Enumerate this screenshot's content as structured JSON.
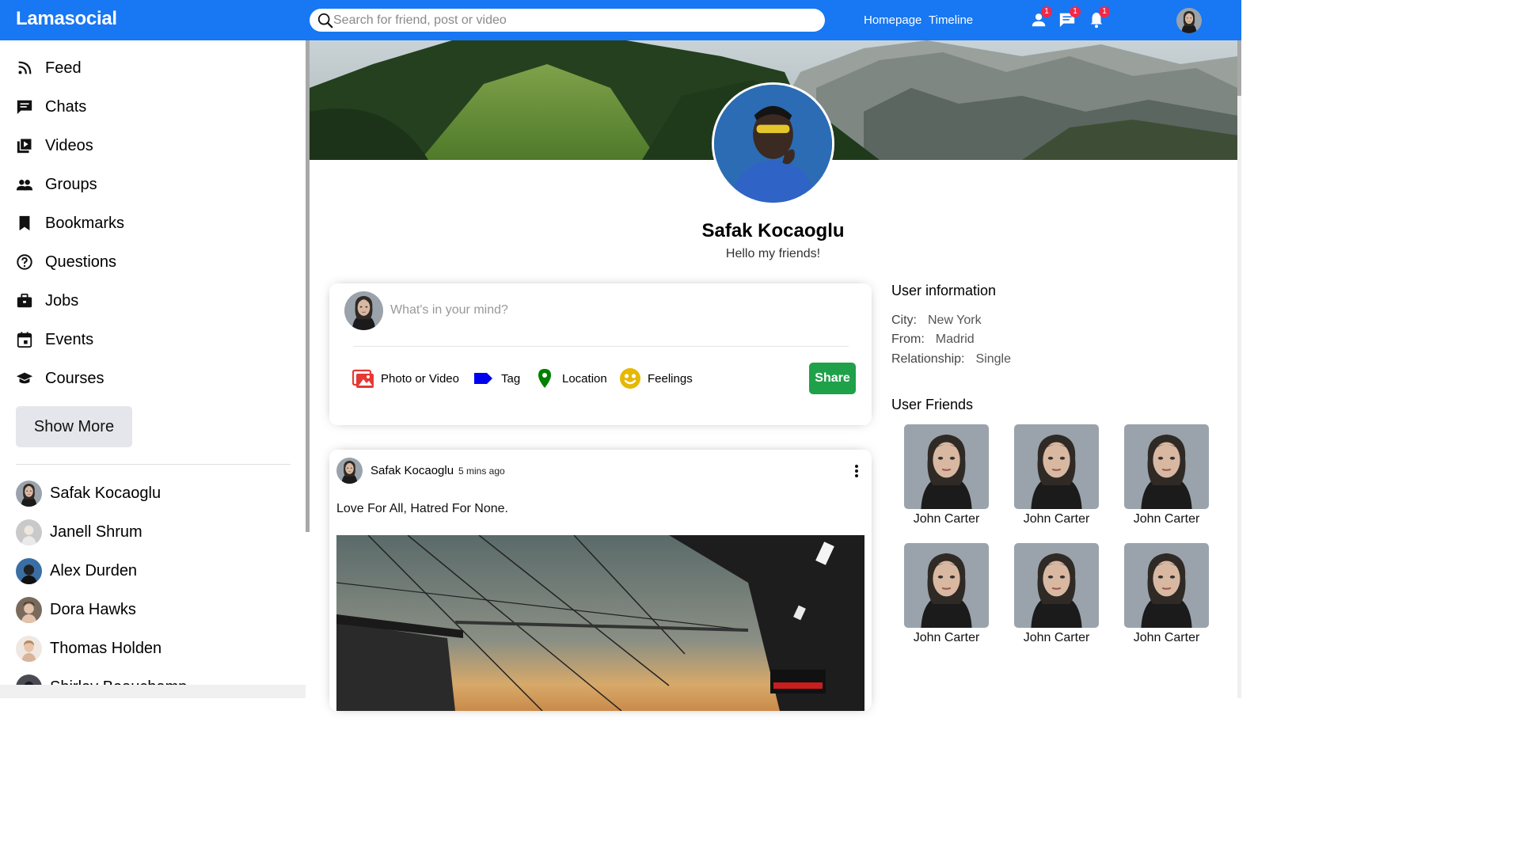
{
  "app": {
    "logo": "Lamasocial"
  },
  "topbar": {
    "search_placeholder": "Search for friend, post or video",
    "links": [
      "Homepage",
      "Timeline"
    ],
    "icons": [
      {
        "name": "person-icon",
        "badge": "1"
      },
      {
        "name": "chat-icon",
        "badge": "1"
      },
      {
        "name": "notification-icon",
        "badge": "1"
      }
    ]
  },
  "sidebar": {
    "items": [
      {
        "label": "Feed",
        "icon": "rss-icon"
      },
      {
        "label": "Chats",
        "icon": "chat-icon"
      },
      {
        "label": "Videos",
        "icon": "video-icon"
      },
      {
        "label": "Groups",
        "icon": "group-icon"
      },
      {
        "label": "Bookmarks",
        "icon": "bookmark-icon"
      },
      {
        "label": "Questions",
        "icon": "help-icon"
      },
      {
        "label": "Jobs",
        "icon": "work-icon"
      },
      {
        "label": "Events",
        "icon": "event-icon"
      },
      {
        "label": "Courses",
        "icon": "school-icon"
      }
    ],
    "show_more": "Show More",
    "friends": [
      "Safak Kocaoglu",
      "Janell Shrum",
      "Alex Durden",
      "Dora Hawks",
      "Thomas Holden",
      "Shirley Beauchamp"
    ]
  },
  "profile": {
    "name": "Safak Kocaoglu",
    "description": "Hello my friends!"
  },
  "share": {
    "placeholder": "What's in your mind?",
    "options": [
      {
        "label": "Photo or Video",
        "icon": "photo-icon",
        "color": "#e53935"
      },
      {
        "label": "Tag",
        "icon": "label-icon",
        "color": "#0000ee"
      },
      {
        "label": "Location",
        "icon": "location-icon",
        "color": "#008000"
      },
      {
        "label": "Feelings",
        "icon": "emoji-icon",
        "color": "#e6b800"
      }
    ],
    "button": "Share"
  },
  "post": {
    "user": "Safak Kocaoglu",
    "date": "5 mins ago",
    "text": "Love For All, Hatred For None."
  },
  "user_info": {
    "title": "User information",
    "rows": [
      {
        "key": "City:",
        "value": "New York"
      },
      {
        "key": "From:",
        "value": "Madrid"
      },
      {
        "key": "Relationship:",
        "value": "Single"
      }
    ]
  },
  "user_friends": {
    "title": "User Friends",
    "names": [
      "John Carter",
      "John Carter",
      "John Carter",
      "John Carter",
      "John Carter",
      "John Carter"
    ]
  },
  "colors": {
    "brand": "#1877f2",
    "share_button": "#1fa14a",
    "badge": "#f02849"
  }
}
